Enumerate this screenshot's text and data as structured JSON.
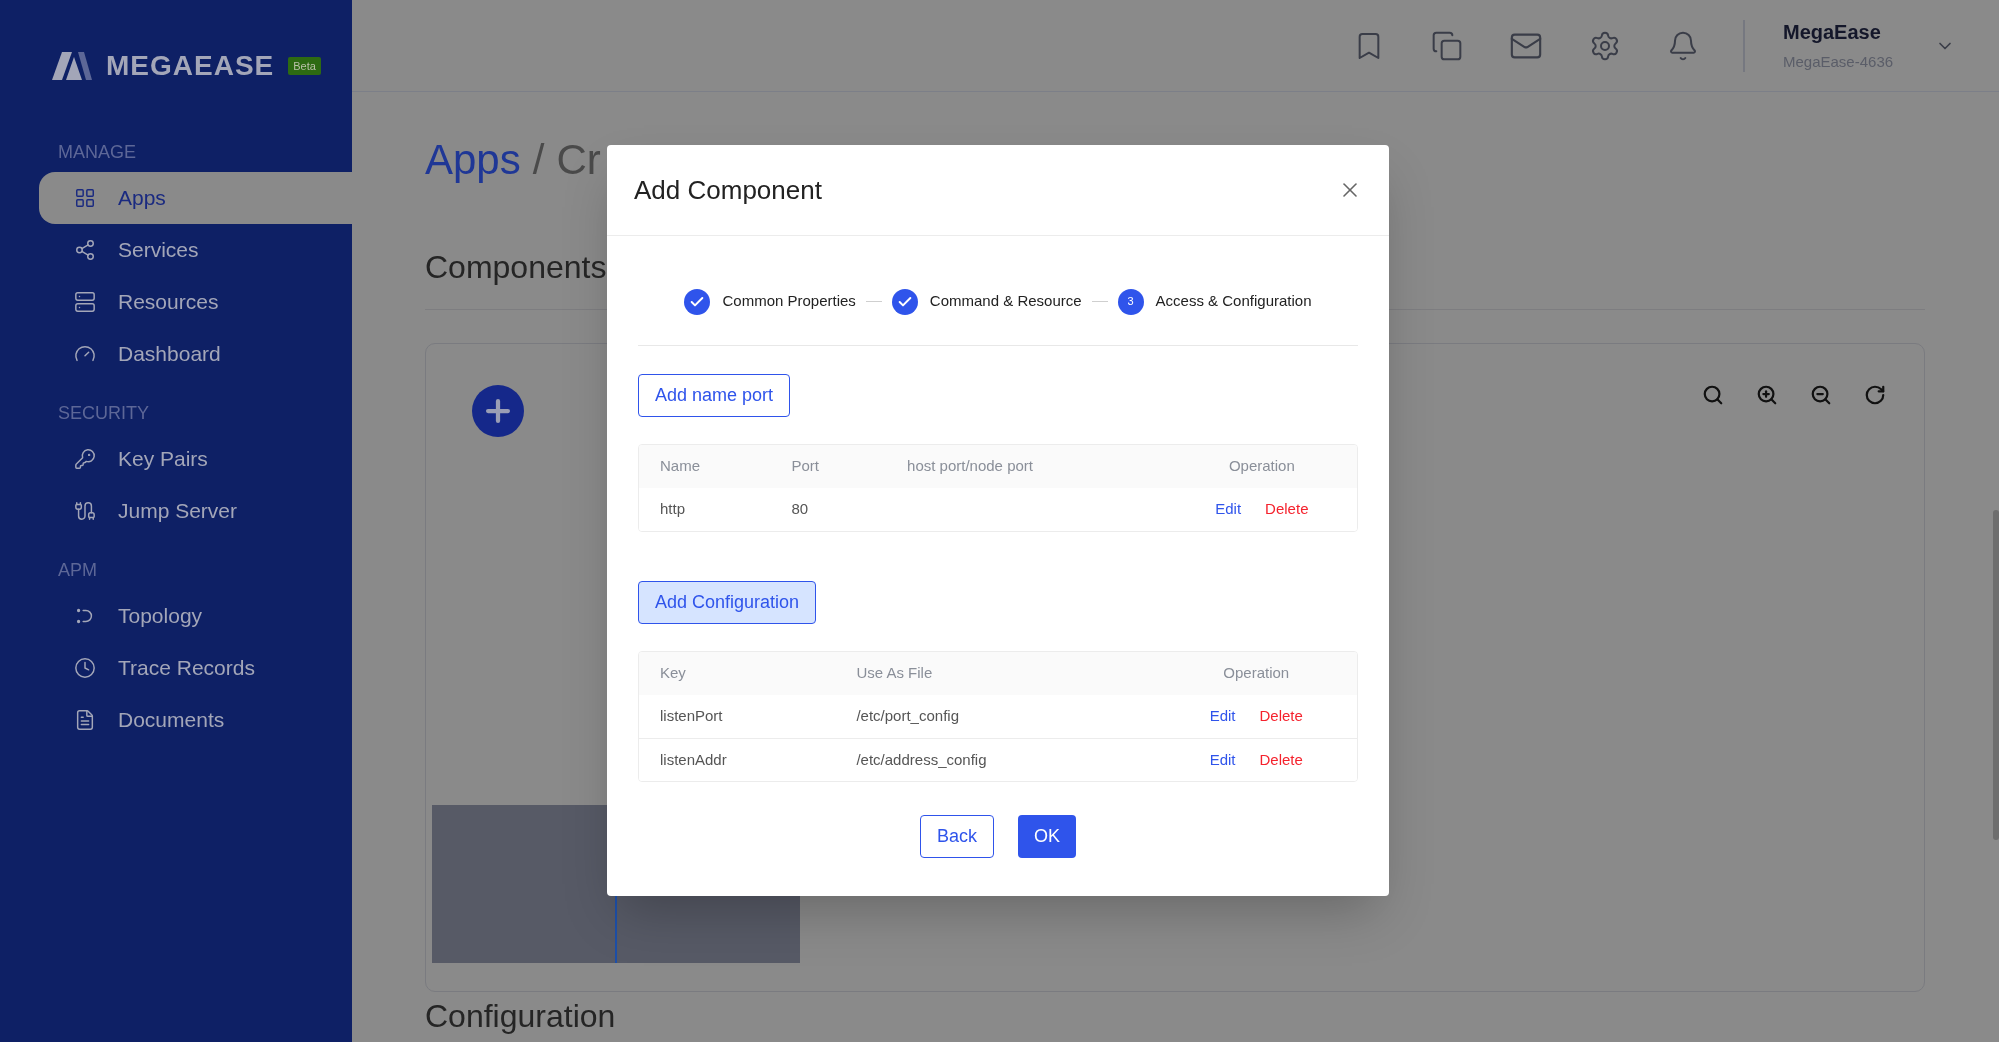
{
  "sidebar": {
    "logo": "MEGAEASE",
    "badge": "Beta",
    "sections": [
      {
        "label": "MANAGE",
        "items": [
          {
            "label": "Apps",
            "selected": true
          },
          {
            "label": "Services",
            "selected": false
          },
          {
            "label": "Resources",
            "selected": false
          },
          {
            "label": "Dashboard",
            "selected": false
          }
        ]
      },
      {
        "label": "SECURITY",
        "items": [
          {
            "label": "Key Pairs",
            "selected": false
          },
          {
            "label": "Jump Server",
            "selected": false
          }
        ]
      },
      {
        "label": "APM",
        "items": [
          {
            "label": "Topology",
            "selected": false
          },
          {
            "label": "Trace Records",
            "selected": false
          },
          {
            "label": "Documents",
            "selected": false
          }
        ]
      }
    ]
  },
  "header": {
    "user": {
      "name": "MegaEase",
      "account": "MegaEase-4636"
    }
  },
  "page": {
    "breadcrumb": {
      "link": "Apps",
      "separator": "/",
      "current": "Cr"
    },
    "components_title": "Components",
    "configuration_title": "Configuration"
  },
  "modal": {
    "title": "Add Component",
    "steps": [
      {
        "label": "Common Properties",
        "completed": true
      },
      {
        "label": "Command & Resource",
        "completed": true
      },
      {
        "label": "Access & Configuration",
        "completed": false,
        "number": "3"
      }
    ],
    "ports": {
      "button": "Add name port",
      "columns": [
        "Name",
        "Port",
        "host port/node port",
        "Operation"
      ],
      "rows": [
        {
          "cells": [
            "http",
            "80",
            ""
          ],
          "actions": [
            "Edit",
            "Delete"
          ]
        }
      ]
    },
    "configuration": {
      "button": "Add Configuration",
      "columns": [
        "Key",
        "Use As File",
        "Operation"
      ],
      "rows": [
        {
          "cells": [
            "listenPort",
            "/etc/port_config"
          ],
          "actions": [
            "Edit",
            "Delete"
          ]
        },
        {
          "cells": [
            "listenAddr",
            "/etc/address_config"
          ],
          "actions": [
            "Edit",
            "Delete"
          ]
        }
      ]
    },
    "buttons": [
      "Back",
      "OK"
    ]
  }
}
